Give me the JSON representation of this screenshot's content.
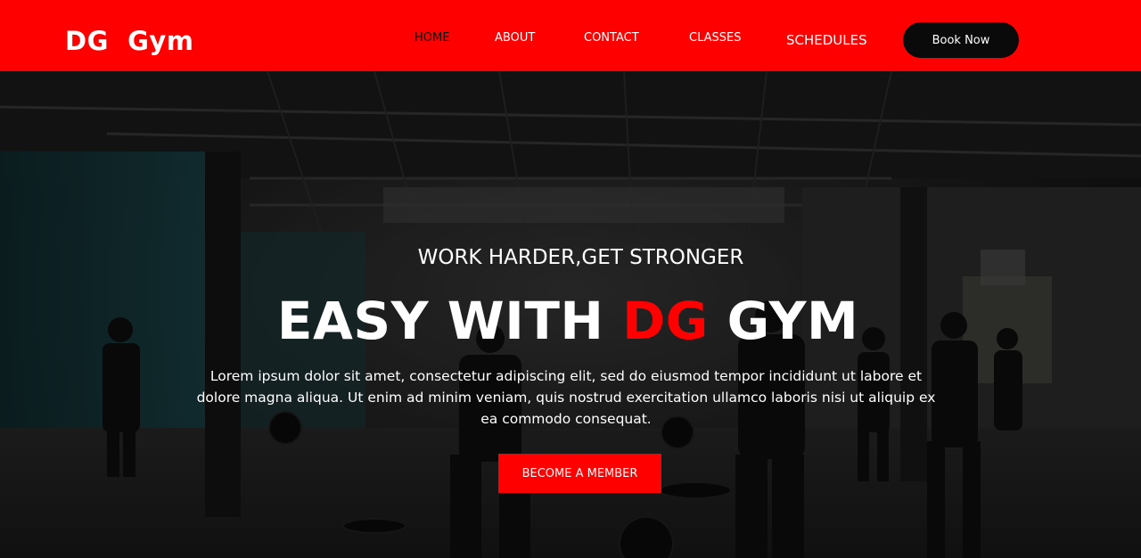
{
  "brand": {
    "logo": "DG  Gym",
    "accent_color": "#ff0000"
  },
  "nav": {
    "items": [
      {
        "label": "HOME",
        "active": true
      },
      {
        "label": "ABOUT",
        "active": false
      },
      {
        "label": "CONTACT",
        "active": false
      },
      {
        "label": "CLASSES",
        "active": false
      },
      {
        "label": "SCHEDULES",
        "active": false
      }
    ],
    "cta_label": "Book Now"
  },
  "hero": {
    "background_image": "dark gym interior with people training",
    "subtitle": "WORK HARDER,GET STRONGER",
    "headline_pre": "EASY WITH ",
    "headline_accent": "DG",
    "headline_post": " GYM",
    "description": "Lorem ipsum dolor sit amet, consectetur adipiscing elit, sed do eiusmod tempor incididunt ut labore et dolore magna aliqua. Ut enim ad minim veniam, quis nostrud exercitation ullamco laboris nisi ut aliquip ex ea commodo consequat.",
    "cta_label": "BECOME A MEMBER"
  }
}
